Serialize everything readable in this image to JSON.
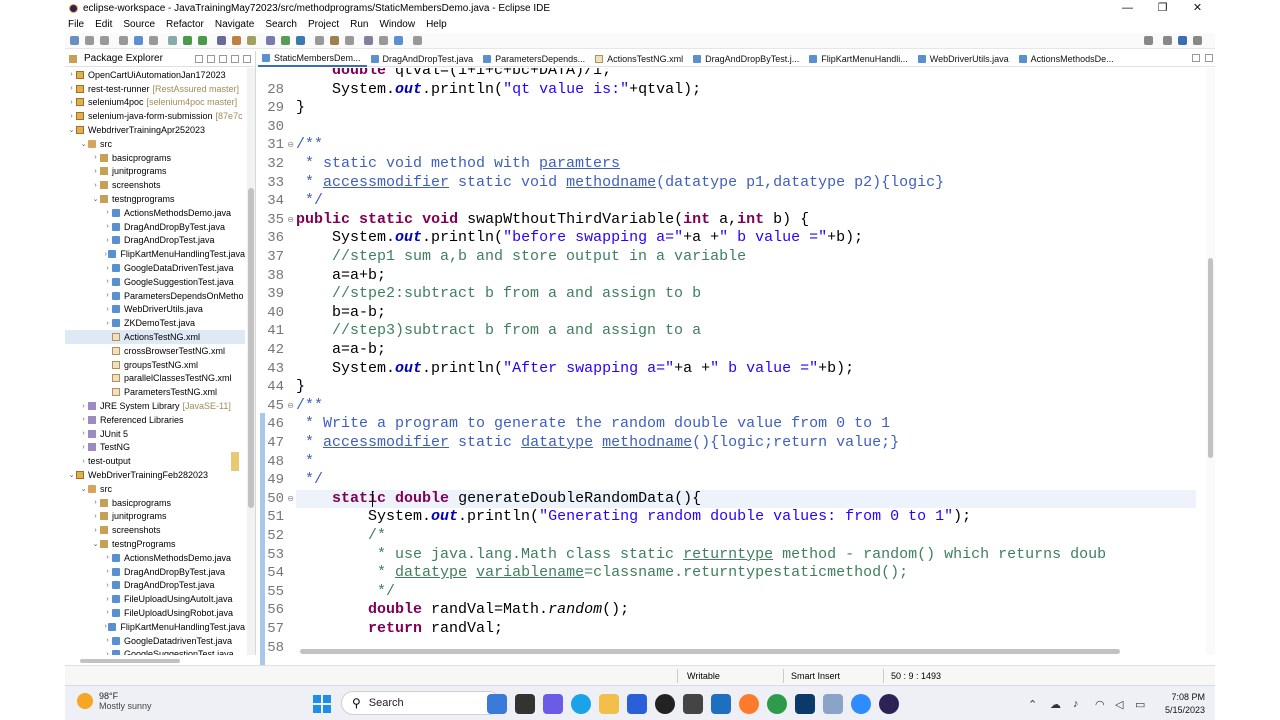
{
  "window": {
    "title": "eclipse-workspace - JavaTrainingMay72023/src/methodprograms/StaticMembersDemo.java - Eclipse IDE",
    "controls": [
      "—",
      "❐",
      "✕"
    ]
  },
  "menu": [
    "File",
    "Edit",
    "Source",
    "Refactor",
    "Navigate",
    "Search",
    "Project",
    "Run",
    "Window",
    "Help"
  ],
  "package_explorer": {
    "title": "Package Explorer",
    "rows": [
      {
        "indent": 0,
        "arrow": "›",
        "icon": "proj",
        "label": "OpenCartUiAutomationJan172023",
        "dec": ""
      },
      {
        "indent": 0,
        "arrow": "›",
        "icon": "proj",
        "label": "rest-test-runner",
        "dec": "[RestAssured master]"
      },
      {
        "indent": 0,
        "arrow": "›",
        "icon": "proj",
        "label": "selenium4poc",
        "dec": "[selenium4poc master]"
      },
      {
        "indent": 0,
        "arrow": "›",
        "icon": "proj",
        "label": "selenium-java-form-submission",
        "dec": "[87e7c"
      },
      {
        "indent": 0,
        "arrow": "⌄",
        "icon": "proj",
        "label": "WebdriverTrainingApr252023",
        "dec": ""
      },
      {
        "indent": 1,
        "arrow": "⌄",
        "icon": "src",
        "label": "src",
        "dec": ""
      },
      {
        "indent": 2,
        "arrow": "›",
        "icon": "pkg",
        "label": "basicprograms",
        "dec": ""
      },
      {
        "indent": 2,
        "arrow": "›",
        "icon": "pkg",
        "label": "junitprograms",
        "dec": ""
      },
      {
        "indent": 2,
        "arrow": "›",
        "icon": "pkg",
        "label": "screenshots",
        "dec": ""
      },
      {
        "indent": 2,
        "arrow": "⌄",
        "icon": "pkg",
        "label": "testngprograms",
        "dec": ""
      },
      {
        "indent": 3,
        "arrow": "›",
        "icon": "java",
        "label": "ActionsMethodsDemo.java",
        "dec": ""
      },
      {
        "indent": 3,
        "arrow": "›",
        "icon": "java",
        "label": "DragAndDropByTest.java",
        "dec": ""
      },
      {
        "indent": 3,
        "arrow": "›",
        "icon": "java",
        "label": "DragAndDropTest.java",
        "dec": ""
      },
      {
        "indent": 3,
        "arrow": "›",
        "icon": "java",
        "label": "FlipKartMenuHandlingTest.java",
        "dec": ""
      },
      {
        "indent": 3,
        "arrow": "›",
        "icon": "java",
        "label": "GoogleDataDrivenTest.java",
        "dec": ""
      },
      {
        "indent": 3,
        "arrow": "›",
        "icon": "java",
        "label": "GoogleSuggestionTest.java",
        "dec": ""
      },
      {
        "indent": 3,
        "arrow": "›",
        "icon": "java",
        "label": "ParametersDependsOnMetho",
        "dec": ""
      },
      {
        "indent": 3,
        "arrow": "›",
        "icon": "java",
        "label": "WebDriverUtils.java",
        "dec": ""
      },
      {
        "indent": 3,
        "arrow": "›",
        "icon": "java",
        "label": "ZKDemoTest.java",
        "dec": ""
      },
      {
        "indent": 3,
        "arrow": "",
        "icon": "xml",
        "label": "ActionsTestNG.xml",
        "dec": "",
        "selected": true
      },
      {
        "indent": 3,
        "arrow": "",
        "icon": "xml",
        "label": "crossBrowserTestNG.xml",
        "dec": ""
      },
      {
        "indent": 3,
        "arrow": "",
        "icon": "xml",
        "label": "groupsTestNG.xml",
        "dec": ""
      },
      {
        "indent": 3,
        "arrow": "",
        "icon": "xml",
        "label": "parallelClassesTestNG.xml",
        "dec": ""
      },
      {
        "indent": 3,
        "arrow": "",
        "icon": "xml",
        "label": "ParametersTestNG.xml",
        "dec": ""
      },
      {
        "indent": 1,
        "arrow": "›",
        "icon": "lib",
        "label": "JRE System Library",
        "dec": "[JavaSE-11]"
      },
      {
        "indent": 1,
        "arrow": "›",
        "icon": "lib",
        "label": "Referenced Libraries",
        "dec": ""
      },
      {
        "indent": 1,
        "arrow": "›",
        "icon": "lib",
        "label": "JUnit 5",
        "dec": ""
      },
      {
        "indent": 1,
        "arrow": "›",
        "icon": "lib",
        "label": "TestNG",
        "dec": ""
      },
      {
        "indent": 1,
        "arrow": "›",
        "icon": "fold",
        "label": "test-output",
        "dec": ""
      },
      {
        "indent": 0,
        "arrow": "⌄",
        "icon": "proj",
        "label": "WebDriverTrainingFeb282023",
        "dec": ""
      },
      {
        "indent": 1,
        "arrow": "⌄",
        "icon": "src",
        "label": "src",
        "dec": ""
      },
      {
        "indent": 2,
        "arrow": "›",
        "icon": "pkg",
        "label": "basicprograms",
        "dec": ""
      },
      {
        "indent": 2,
        "arrow": "›",
        "icon": "pkg",
        "label": "junitprograms",
        "dec": ""
      },
      {
        "indent": 2,
        "arrow": "›",
        "icon": "pkg",
        "label": "screenshots",
        "dec": ""
      },
      {
        "indent": 2,
        "arrow": "⌄",
        "icon": "pkg",
        "label": "testngPrograms",
        "dec": ""
      },
      {
        "indent": 3,
        "arrow": "›",
        "icon": "java",
        "label": "ActionsMethodsDemo.java",
        "dec": ""
      },
      {
        "indent": 3,
        "arrow": "›",
        "icon": "java",
        "label": "DragAndDropByTest.java",
        "dec": ""
      },
      {
        "indent": 3,
        "arrow": "›",
        "icon": "java",
        "label": "DragAndDropTest.java",
        "dec": ""
      },
      {
        "indent": 3,
        "arrow": "›",
        "icon": "java",
        "label": "FileUploadUsingAutoIt.java",
        "dec": ""
      },
      {
        "indent": 3,
        "arrow": "›",
        "icon": "java",
        "label": "FileUploadUsingRobot.java",
        "dec": ""
      },
      {
        "indent": 3,
        "arrow": "›",
        "icon": "java",
        "label": "FlipKartMenuHandlingTest.java",
        "dec": ""
      },
      {
        "indent": 3,
        "arrow": "›",
        "icon": "java",
        "label": "GoogleDatadrivenTest.java",
        "dec": ""
      },
      {
        "indent": 3,
        "arrow": "›",
        "icon": "java",
        "label": "GoogleSuggestionTest.java",
        "dec": ""
      }
    ]
  },
  "editor": {
    "tabs": [
      {
        "label": "StaticMembersDem...",
        "icon": "java",
        "active": true
      },
      {
        "label": "DragAndDropTest.java",
        "icon": "java"
      },
      {
        "label": "ParametersDepends...",
        "icon": "java"
      },
      {
        "label": "ActionsTestNG.xml",
        "icon": "xml"
      },
      {
        "label": "DragAndDropByTest.j...",
        "icon": "java"
      },
      {
        "label": "FlipKartMenuHandli...",
        "icon": "java"
      },
      {
        "label": "WebDriverUtils.java",
        "icon": "java"
      },
      {
        "label": "ActionsMethodsDe...",
        "icon": "java"
      }
    ],
    "lines": [
      {
        "n": "",
        "fold": "",
        "segs": [
          [
            "",
            "    "
          ],
          [
            "kw",
            "double"
          ],
          [
            "",
            " qtval=(1+i+c+bc+DATA)/i;"
          ]
        ]
      },
      {
        "n": "28",
        "fold": "",
        "segs": [
          [
            "",
            "    System."
          ],
          [
            "fi",
            "out"
          ],
          [
            "",
            ".println("
          ],
          [
            "st",
            "\"qt value is:\""
          ],
          [
            "",
            "+qtval);"
          ]
        ]
      },
      {
        "n": "29",
        "fold": "",
        "segs": [
          [
            "",
            "}"
          ]
        ]
      },
      {
        "n": "30",
        "fold": "",
        "segs": [
          [
            "",
            ""
          ]
        ]
      },
      {
        "n": "31",
        "fold": "⊖",
        "segs": [
          [
            "cm",
            "/**"
          ]
        ]
      },
      {
        "n": "32",
        "fold": "",
        "segs": [
          [
            "cm",
            " * static void method with "
          ],
          [
            "cm ul",
            "paramters"
          ]
        ]
      },
      {
        "n": "33",
        "fold": "",
        "segs": [
          [
            "cm",
            " * "
          ],
          [
            "cm ul",
            "accessmodifier"
          ],
          [
            "cm",
            " static void "
          ],
          [
            "cm ul",
            "methodname"
          ],
          [
            "cm",
            "(datatype p1,datatype p2){logic}"
          ]
        ]
      },
      {
        "n": "34",
        "fold": "",
        "segs": [
          [
            "cm",
            " */"
          ]
        ]
      },
      {
        "n": "35",
        "fold": "⊖",
        "segs": [
          [
            "kw",
            "public"
          ],
          [
            "",
            " "
          ],
          [
            "kw",
            "static"
          ],
          [
            "",
            " "
          ],
          [
            "kw",
            "void"
          ],
          [
            "",
            " swapWthoutThirdVariable("
          ],
          [
            "kw",
            "int"
          ],
          [
            "",
            " a,"
          ],
          [
            "kw",
            "int"
          ],
          [
            "",
            " b) {"
          ]
        ]
      },
      {
        "n": "36",
        "fold": "",
        "segs": [
          [
            "",
            "    System."
          ],
          [
            "fi",
            "out"
          ],
          [
            "",
            ".println("
          ],
          [
            "st",
            "\"before swapping a=\""
          ],
          [
            "",
            "+a +"
          ],
          [
            "st",
            "\" b value =\""
          ],
          [
            "",
            "+b);"
          ]
        ]
      },
      {
        "n": "37",
        "fold": "",
        "segs": [
          [
            "sc",
            "    //step1 sum a,b and store output in a variable"
          ]
        ]
      },
      {
        "n": "38",
        "fold": "",
        "segs": [
          [
            "",
            "    a=a+b;"
          ]
        ]
      },
      {
        "n": "39",
        "fold": "",
        "segs": [
          [
            "sc",
            "    //stpe2:subtract b from a and assign to b"
          ]
        ]
      },
      {
        "n": "40",
        "fold": "",
        "segs": [
          [
            "",
            "    b=a-b;"
          ]
        ]
      },
      {
        "n": "41",
        "fold": "",
        "segs": [
          [
            "sc",
            "    //step3)subtract b from a and assign to a"
          ]
        ]
      },
      {
        "n": "42",
        "fold": "",
        "segs": [
          [
            "",
            "    a=a-b;"
          ]
        ]
      },
      {
        "n": "43",
        "fold": "",
        "segs": [
          [
            "",
            "    System."
          ],
          [
            "fi",
            "out"
          ],
          [
            "",
            ".println("
          ],
          [
            "st",
            "\"After swapping a=\""
          ],
          [
            "",
            "+a +"
          ],
          [
            "st",
            "\" b value =\""
          ],
          [
            "",
            "+b);"
          ]
        ]
      },
      {
        "n": "44",
        "fold": "",
        "segs": [
          [
            "",
            "}"
          ]
        ]
      },
      {
        "n": "45",
        "fold": "⊖",
        "segs": [
          [
            "cm",
            "/**"
          ]
        ]
      },
      {
        "n": "46",
        "fold": "",
        "segs": [
          [
            "cm",
            " * Write a program to generate the random double value from 0 to 1"
          ]
        ]
      },
      {
        "n": "47",
        "fold": "",
        "segs": [
          [
            "cm",
            " * "
          ],
          [
            "cm ul",
            "accessmodifier"
          ],
          [
            "cm",
            " static "
          ],
          [
            "cm ul",
            "datatype"
          ],
          [
            "cm",
            " "
          ],
          [
            "cm ul",
            "methodname"
          ],
          [
            "cm",
            "(){logic;return value;}"
          ]
        ]
      },
      {
        "n": "48",
        "fold": "",
        "segs": [
          [
            "cm",
            " *"
          ]
        ]
      },
      {
        "n": "49",
        "fold": "",
        "segs": [
          [
            "cm",
            " */"
          ]
        ]
      },
      {
        "n": "50",
        "fold": "⊖",
        "cur": true,
        "segs": [
          [
            "",
            "    "
          ],
          [
            "kw",
            "static"
          ],
          [
            "",
            " "
          ],
          [
            "kw",
            "double"
          ],
          [
            "",
            " generateDoubleRandomData(){"
          ]
        ]
      },
      {
        "n": "51",
        "fold": "",
        "segs": [
          [
            "",
            "        System."
          ],
          [
            "fi",
            "out"
          ],
          [
            "",
            ".println("
          ],
          [
            "st",
            "\"Generating random double values: from 0 to 1\""
          ],
          [
            "",
            ");"
          ]
        ]
      },
      {
        "n": "52",
        "fold": "",
        "segs": [
          [
            "sc",
            "        /*"
          ]
        ]
      },
      {
        "n": "53",
        "fold": "",
        "segs": [
          [
            "sc",
            "         * use java.lang.Math class static "
          ],
          [
            "sc ul",
            "returntype"
          ],
          [
            "sc",
            " method - random() which returns doub"
          ]
        ]
      },
      {
        "n": "54",
        "fold": "",
        "segs": [
          [
            "sc",
            "         * "
          ],
          [
            "sc ul",
            "datatype"
          ],
          [
            "sc",
            " "
          ],
          [
            "sc ul",
            "variablename"
          ],
          [
            "sc",
            "=classname.returntypestaticmethod();"
          ]
        ]
      },
      {
        "n": "55",
        "fold": "",
        "segs": [
          [
            "sc",
            "         */"
          ]
        ]
      },
      {
        "n": "56",
        "fold": "",
        "segs": [
          [
            "",
            "        "
          ],
          [
            "kw",
            "double"
          ],
          [
            "",
            " randVal=Math."
          ],
          [
            "it",
            "random"
          ],
          [
            "",
            "();"
          ]
        ]
      },
      {
        "n": "57",
        "fold": "",
        "segs": [
          [
            "",
            "        "
          ],
          [
            "kw",
            "return"
          ],
          [
            "",
            " randVal;"
          ]
        ]
      },
      {
        "n": "58",
        "fold": "",
        "segs": [
          [
            "",
            ""
          ]
        ]
      }
    ]
  },
  "status": {
    "mode": "Writable",
    "insert": "Smart Insert",
    "position": "50 : 9 : 1493"
  },
  "taskbar": {
    "temp": "98°F",
    "weather": "Mostly sunny",
    "search": "Search",
    "time": "7:08 PM",
    "date": "5/15/2023"
  }
}
